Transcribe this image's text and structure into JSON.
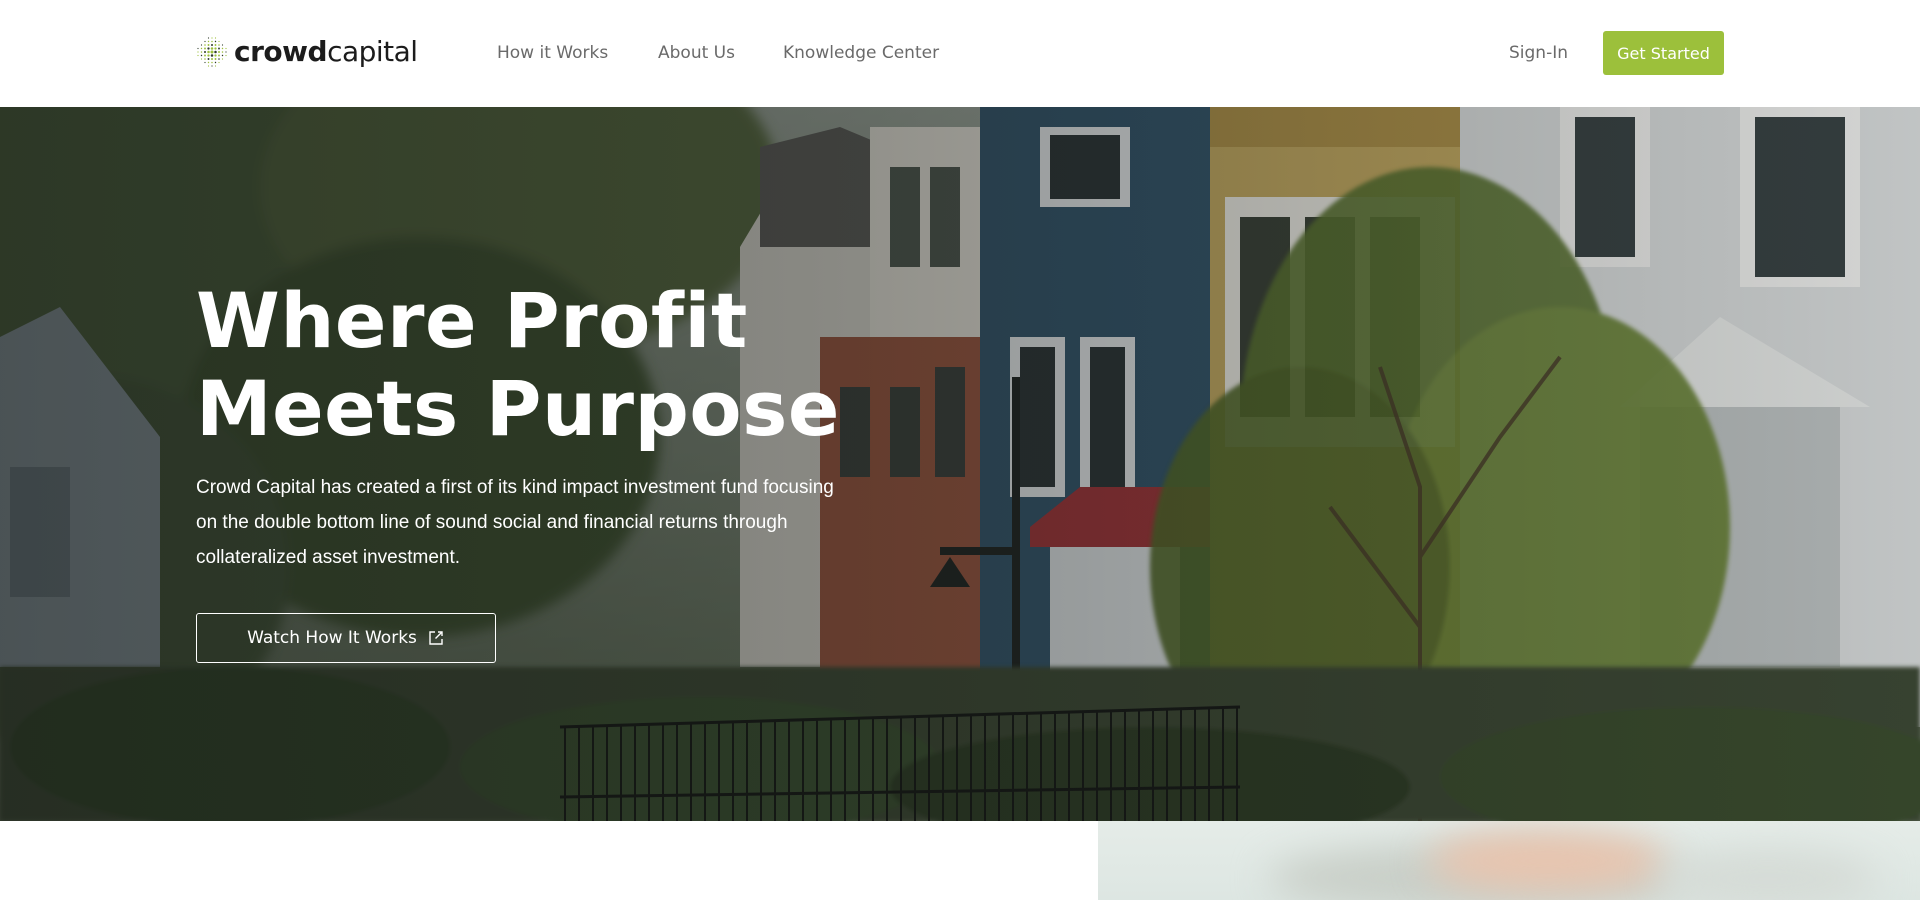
{
  "header": {
    "logo": {
      "bold_text": "crowd",
      "light_text": "capital",
      "icon": "dotted-sphere-logo-icon",
      "brand_color": "#9cc03b"
    },
    "nav": [
      {
        "label": "How it Works"
      },
      {
        "label": "About Us"
      },
      {
        "label": "Knowledge Center"
      }
    ],
    "sign_in_label": "Sign-In",
    "cta_label": "Get Started"
  },
  "hero": {
    "title_line1": "Where Profit",
    "title_line2": "Meets Purpose",
    "description": "Crowd Capital has created a first of its kind impact investment fund focusing on the double bottom line of sound social and financial returns through collateralized asset investment.",
    "button_label": "Watch How It Works",
    "button_icon": "external-link-icon",
    "background": "photo-of-colorful-townhouses-with-trees"
  },
  "colors": {
    "accent": "#9cc03b",
    "nav_text": "#6a6a6a",
    "logo_text": "#1c1c1c",
    "hero_text": "#ffffff"
  }
}
